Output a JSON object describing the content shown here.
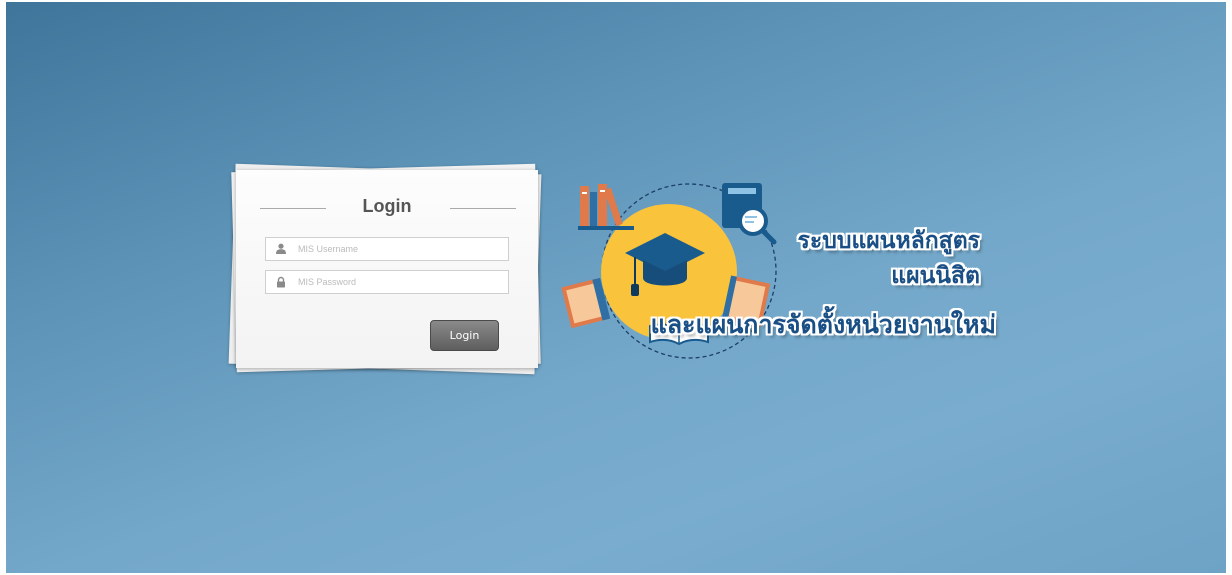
{
  "login": {
    "title": "Login",
    "username_placeholder": "MIS Username",
    "password_placeholder": "MIS Password",
    "button_label": "Login"
  },
  "logo": {
    "line1": "ระบบแผนหลักสูตร",
    "line2": "แผนนิสิต",
    "line3": "และแผนการจัดตั้งหน่วยงานใหม่",
    "colors": {
      "text": "#1a4f86",
      "circle": "#f9c43c",
      "cap": "#1a5b8e",
      "book_orange": "#e07a4a"
    }
  },
  "icons": [
    "user-icon",
    "lock-icon",
    "graduation-cap-icon",
    "magnifier-icon",
    "books-icon"
  ],
  "colors": {
    "background_dark": "#3f759a",
    "background_light": "#79acce",
    "button": "#6e6e6e"
  }
}
